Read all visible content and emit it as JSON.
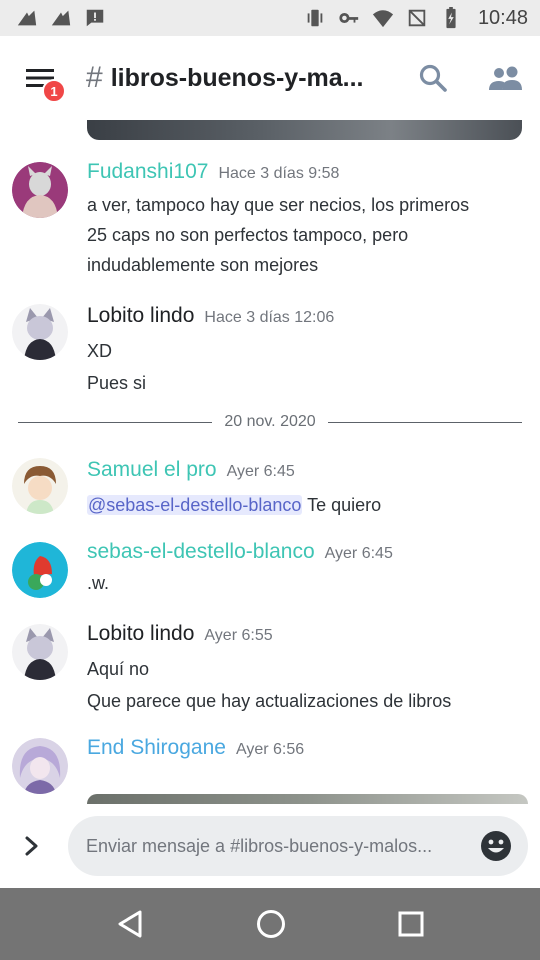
{
  "status_bar": {
    "time": "10:48",
    "icons": [
      "signal-icon",
      "signal-icon",
      "alert-icon",
      "vibrate-icon",
      "key-icon",
      "wifi-icon",
      "no-sim-icon",
      "battery-icon"
    ]
  },
  "header": {
    "channel_name": "libros-buenos-y-ma...",
    "notification_count": "1"
  },
  "date_separator": "20 nov. 2020",
  "messages": [
    {
      "author": "Fudanshi107",
      "author_color": "#3ec5b4",
      "timestamp": "Hace 3 días 9:58",
      "lines": [
        "a ver, tampoco hay que ser necios, los primeros",
        "25 caps no son perfectos tampoco, pero",
        "indudablemente son mejores"
      ]
    },
    {
      "author": "Lobito lindo",
      "author_color": "#202225",
      "timestamp": "Hace 3 días 12:06",
      "lines": [
        "XD",
        "Pues si"
      ]
    },
    {
      "author": "Samuel el pro",
      "author_color": "#3ec5b4",
      "timestamp": "Ayer 6:45",
      "mention": "@sebas-el-destello-blanco",
      "text_after_mention": " Te quiero"
    },
    {
      "author": "sebas-el-destello-blanco",
      "author_color": "#3ec5b4",
      "timestamp": "Ayer 6:45",
      "lines": [
        ".w."
      ]
    },
    {
      "author": "Lobito lindo",
      "author_color": "#202225",
      "timestamp": "Ayer 6:55",
      "lines": [
        "Aquí no",
        "Que parece que hay actualizaciones de libros"
      ]
    },
    {
      "author": "End Shirogane",
      "author_color": "#4aa8e0",
      "timestamp": "Ayer 6:56",
      "lines": []
    }
  ],
  "composer": {
    "placeholder": "Enviar mensaje a #libros-buenos-y-malos..."
  },
  "nav_bar": {
    "icons": [
      "back-icon",
      "home-icon",
      "recents-icon"
    ]
  }
}
